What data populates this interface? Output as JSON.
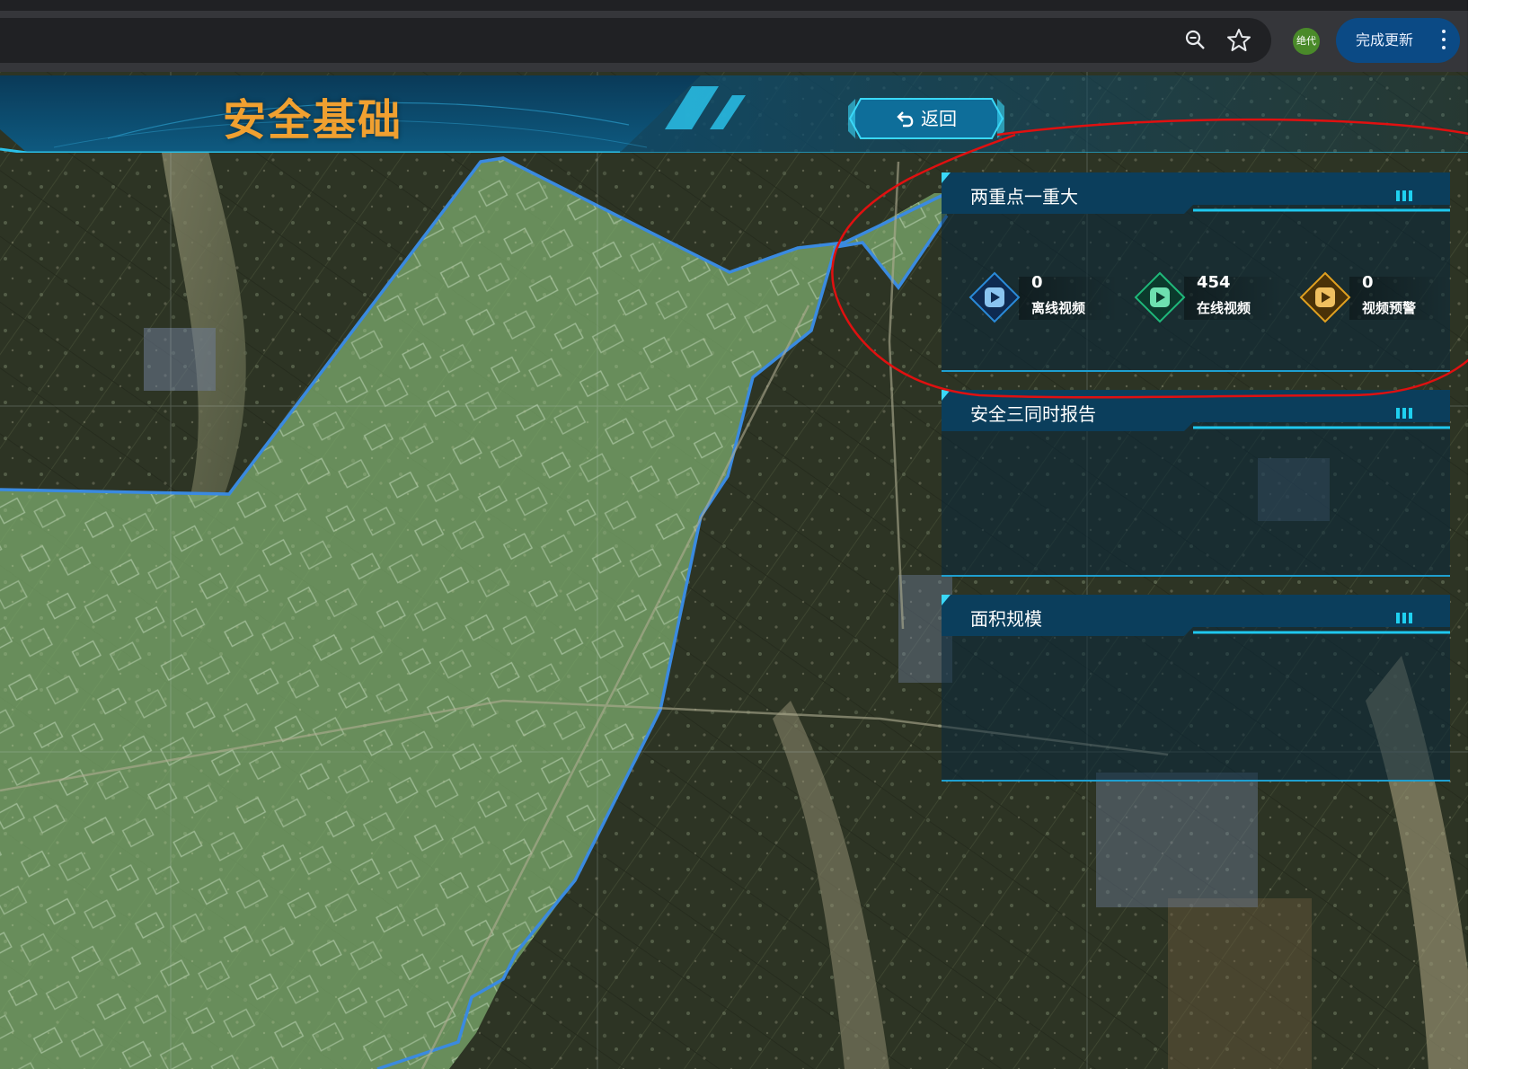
{
  "browser": {
    "profile_badge": "绝代",
    "update_button": "完成更新"
  },
  "header": {
    "title": "安全基础",
    "back_button": "返回"
  },
  "panels": {
    "key_points": {
      "title": "两重点一重大",
      "stats": [
        {
          "value": "0",
          "label": "离线视频",
          "color": "#2a8ad8"
        },
        {
          "value": "454",
          "label": "在线视频",
          "color": "#1fb87a"
        },
        {
          "value": "0",
          "label": "视频预警",
          "color": "#e0a020"
        }
      ]
    },
    "safety_report": {
      "title": "安全三同时报告"
    },
    "area_scale": {
      "title": "面积规模"
    }
  },
  "colors": {
    "accent": "#1fd0f0",
    "title_orange": "#f0a030",
    "annotation": "#e01010",
    "boundary": "#3a8ae0"
  }
}
